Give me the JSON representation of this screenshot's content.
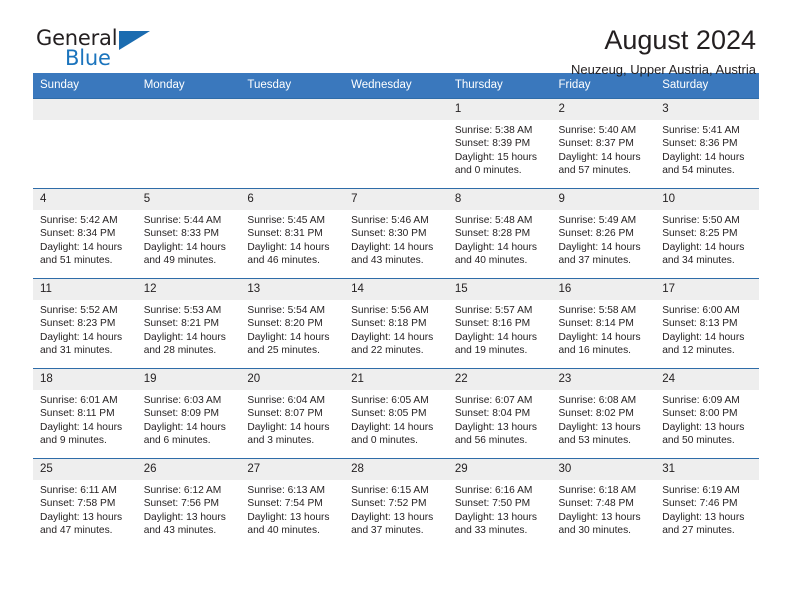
{
  "brand": {
    "name_top": "General",
    "name_bottom": "Blue",
    "triangle_color": "#1b6cb0",
    "blue_text_color": "#1b74bd"
  },
  "header": {
    "title": "August 2024",
    "subtitle": "Neuzeug, Upper Austria, Austria"
  },
  "theme": {
    "header_row_bg": "#3a78bd",
    "header_row_text": "#ffffff",
    "daynum_bg": "#eeeeee",
    "cell_border": "#2f6ca8",
    "body_text": "#231f20"
  },
  "calendar": {
    "weekday_headers": [
      "Sunday",
      "Monday",
      "Tuesday",
      "Wednesday",
      "Thursday",
      "Friday",
      "Saturday"
    ],
    "labels": {
      "sunrise": "Sunrise:",
      "sunset": "Sunset:",
      "daylight": "Daylight:"
    },
    "weeks": [
      [
        {
          "day": "",
          "sunrise": "",
          "sunset": "",
          "daylight": ""
        },
        {
          "day": "",
          "sunrise": "",
          "sunset": "",
          "daylight": ""
        },
        {
          "day": "",
          "sunrise": "",
          "sunset": "",
          "daylight": ""
        },
        {
          "day": "",
          "sunrise": "",
          "sunset": "",
          "daylight": ""
        },
        {
          "day": "1",
          "sunrise": "Sunrise: 5:38 AM",
          "sunset": "Sunset: 8:39 PM",
          "daylight": "Daylight: 15 hours and 0 minutes."
        },
        {
          "day": "2",
          "sunrise": "Sunrise: 5:40 AM",
          "sunset": "Sunset: 8:37 PM",
          "daylight": "Daylight: 14 hours and 57 minutes."
        },
        {
          "day": "3",
          "sunrise": "Sunrise: 5:41 AM",
          "sunset": "Sunset: 8:36 PM",
          "daylight": "Daylight: 14 hours and 54 minutes."
        }
      ],
      [
        {
          "day": "4",
          "sunrise": "Sunrise: 5:42 AM",
          "sunset": "Sunset: 8:34 PM",
          "daylight": "Daylight: 14 hours and 51 minutes."
        },
        {
          "day": "5",
          "sunrise": "Sunrise: 5:44 AM",
          "sunset": "Sunset: 8:33 PM",
          "daylight": "Daylight: 14 hours and 49 minutes."
        },
        {
          "day": "6",
          "sunrise": "Sunrise: 5:45 AM",
          "sunset": "Sunset: 8:31 PM",
          "daylight": "Daylight: 14 hours and 46 minutes."
        },
        {
          "day": "7",
          "sunrise": "Sunrise: 5:46 AM",
          "sunset": "Sunset: 8:30 PM",
          "daylight": "Daylight: 14 hours and 43 minutes."
        },
        {
          "day": "8",
          "sunrise": "Sunrise: 5:48 AM",
          "sunset": "Sunset: 8:28 PM",
          "daylight": "Daylight: 14 hours and 40 minutes."
        },
        {
          "day": "9",
          "sunrise": "Sunrise: 5:49 AM",
          "sunset": "Sunset: 8:26 PM",
          "daylight": "Daylight: 14 hours and 37 minutes."
        },
        {
          "day": "10",
          "sunrise": "Sunrise: 5:50 AM",
          "sunset": "Sunset: 8:25 PM",
          "daylight": "Daylight: 14 hours and 34 minutes."
        }
      ],
      [
        {
          "day": "11",
          "sunrise": "Sunrise: 5:52 AM",
          "sunset": "Sunset: 8:23 PM",
          "daylight": "Daylight: 14 hours and 31 minutes."
        },
        {
          "day": "12",
          "sunrise": "Sunrise: 5:53 AM",
          "sunset": "Sunset: 8:21 PM",
          "daylight": "Daylight: 14 hours and 28 minutes."
        },
        {
          "day": "13",
          "sunrise": "Sunrise: 5:54 AM",
          "sunset": "Sunset: 8:20 PM",
          "daylight": "Daylight: 14 hours and 25 minutes."
        },
        {
          "day": "14",
          "sunrise": "Sunrise: 5:56 AM",
          "sunset": "Sunset: 8:18 PM",
          "daylight": "Daylight: 14 hours and 22 minutes."
        },
        {
          "day": "15",
          "sunrise": "Sunrise: 5:57 AM",
          "sunset": "Sunset: 8:16 PM",
          "daylight": "Daylight: 14 hours and 19 minutes."
        },
        {
          "day": "16",
          "sunrise": "Sunrise: 5:58 AM",
          "sunset": "Sunset: 8:14 PM",
          "daylight": "Daylight: 14 hours and 16 minutes."
        },
        {
          "day": "17",
          "sunrise": "Sunrise: 6:00 AM",
          "sunset": "Sunset: 8:13 PM",
          "daylight": "Daylight: 14 hours and 12 minutes."
        }
      ],
      [
        {
          "day": "18",
          "sunrise": "Sunrise: 6:01 AM",
          "sunset": "Sunset: 8:11 PM",
          "daylight": "Daylight: 14 hours and 9 minutes."
        },
        {
          "day": "19",
          "sunrise": "Sunrise: 6:03 AM",
          "sunset": "Sunset: 8:09 PM",
          "daylight": "Daylight: 14 hours and 6 minutes."
        },
        {
          "day": "20",
          "sunrise": "Sunrise: 6:04 AM",
          "sunset": "Sunset: 8:07 PM",
          "daylight": "Daylight: 14 hours and 3 minutes."
        },
        {
          "day": "21",
          "sunrise": "Sunrise: 6:05 AM",
          "sunset": "Sunset: 8:05 PM",
          "daylight": "Daylight: 14 hours and 0 minutes."
        },
        {
          "day": "22",
          "sunrise": "Sunrise: 6:07 AM",
          "sunset": "Sunset: 8:04 PM",
          "daylight": "Daylight: 13 hours and 56 minutes."
        },
        {
          "day": "23",
          "sunrise": "Sunrise: 6:08 AM",
          "sunset": "Sunset: 8:02 PM",
          "daylight": "Daylight: 13 hours and 53 minutes."
        },
        {
          "day": "24",
          "sunrise": "Sunrise: 6:09 AM",
          "sunset": "Sunset: 8:00 PM",
          "daylight": "Daylight: 13 hours and 50 minutes."
        }
      ],
      [
        {
          "day": "25",
          "sunrise": "Sunrise: 6:11 AM",
          "sunset": "Sunset: 7:58 PM",
          "daylight": "Daylight: 13 hours and 47 minutes."
        },
        {
          "day": "26",
          "sunrise": "Sunrise: 6:12 AM",
          "sunset": "Sunset: 7:56 PM",
          "daylight": "Daylight: 13 hours and 43 minutes."
        },
        {
          "day": "27",
          "sunrise": "Sunrise: 6:13 AM",
          "sunset": "Sunset: 7:54 PM",
          "daylight": "Daylight: 13 hours and 40 minutes."
        },
        {
          "day": "28",
          "sunrise": "Sunrise: 6:15 AM",
          "sunset": "Sunset: 7:52 PM",
          "daylight": "Daylight: 13 hours and 37 minutes."
        },
        {
          "day": "29",
          "sunrise": "Sunrise: 6:16 AM",
          "sunset": "Sunset: 7:50 PM",
          "daylight": "Daylight: 13 hours and 33 minutes."
        },
        {
          "day": "30",
          "sunrise": "Sunrise: 6:18 AM",
          "sunset": "Sunset: 7:48 PM",
          "daylight": "Daylight: 13 hours and 30 minutes."
        },
        {
          "day": "31",
          "sunrise": "Sunrise: 6:19 AM",
          "sunset": "Sunset: 7:46 PM",
          "daylight": "Daylight: 13 hours and 27 minutes."
        }
      ]
    ]
  }
}
